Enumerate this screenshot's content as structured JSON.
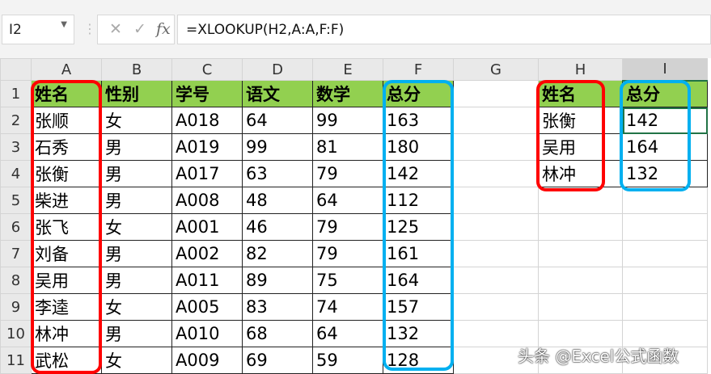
{
  "name_box": "I2",
  "formula": "=XLOOKUP(H2,A:A,F:F)",
  "icons": {
    "cancel": "✕",
    "enter": "✓",
    "fx": "fx"
  },
  "columns": [
    "A",
    "B",
    "C",
    "D",
    "E",
    "F",
    "G",
    "H",
    "I"
  ],
  "rows": [
    [
      "姓名",
      "性别",
      "学号",
      "语文",
      "数学",
      "总分",
      "",
      "姓名",
      "总分"
    ],
    [
      "张顺",
      "女",
      "A018",
      "64",
      "99",
      "163",
      "",
      "张衡",
      "142"
    ],
    [
      "石秀",
      "男",
      "A019",
      "99",
      "81",
      "180",
      "",
      "吴用",
      "164"
    ],
    [
      "张衡",
      "男",
      "A017",
      "63",
      "79",
      "142",
      "",
      "林冲",
      "132"
    ],
    [
      "柴进",
      "男",
      "A008",
      "48",
      "64",
      "112",
      "",
      "",
      ""
    ],
    [
      "张飞",
      "女",
      "A001",
      "46",
      "79",
      "125",
      "",
      "",
      ""
    ],
    [
      "刘备",
      "男",
      "A002",
      "82",
      "79",
      "161",
      "",
      "",
      ""
    ],
    [
      "吴用",
      "男",
      "A011",
      "89",
      "75",
      "164",
      "",
      "",
      ""
    ],
    [
      "李逵",
      "女",
      "A005",
      "83",
      "74",
      "157",
      "",
      "",
      ""
    ],
    [
      "林冲",
      "男",
      "A010",
      "68",
      "64",
      "132",
      "",
      "",
      ""
    ],
    [
      "武松",
      "女",
      "A009",
      "69",
      "59",
      "128",
      "",
      "",
      ""
    ]
  ],
  "row_numbers": [
    "1",
    "2",
    "3",
    "4",
    "5",
    "6",
    "7",
    "8",
    "9",
    "10",
    "11"
  ],
  "watermark": "头条 @Excel公式函数"
}
